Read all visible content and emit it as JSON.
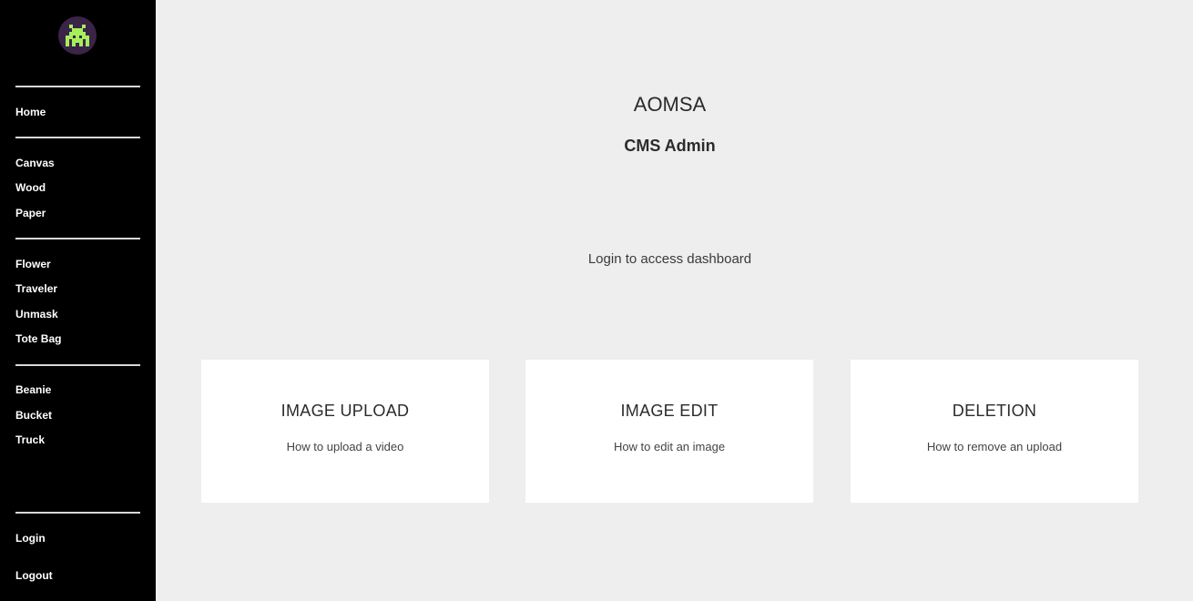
{
  "sidebar": {
    "logo_icon": "space-invader-icon",
    "logo_colors": {
      "background": "#3a2448",
      "glyph": "#a6ef5a"
    },
    "groups": [
      {
        "items": [
          {
            "label": "Home"
          }
        ]
      },
      {
        "items": [
          {
            "label": "Canvas"
          },
          {
            "label": "Wood"
          },
          {
            "label": "Paper"
          }
        ]
      },
      {
        "items": [
          {
            "label": "Flower"
          },
          {
            "label": "Traveler"
          },
          {
            "label": "Unmask"
          },
          {
            "label": "Tote Bag"
          }
        ]
      },
      {
        "items": [
          {
            "label": "Beanie"
          },
          {
            "label": "Bucket"
          },
          {
            "label": "Truck"
          }
        ]
      }
    ],
    "auth": {
      "login_label": "Login",
      "logout_label": "Logout"
    }
  },
  "main": {
    "title": "AOMSA",
    "subtitle": "CMS Admin",
    "login_prompt": "Login to access dashboard",
    "cards": [
      {
        "title": "IMAGE UPLOAD",
        "description": "How to upload a video"
      },
      {
        "title": "IMAGE EDIT",
        "description": "How to edit an image"
      },
      {
        "title": "DELETION",
        "description": "How to remove an upload"
      }
    ]
  },
  "colors": {
    "sidebar_bg": "#000000",
    "main_bg": "#eeeeee",
    "card_bg": "#ffffff",
    "text": "#2b2b2b"
  }
}
